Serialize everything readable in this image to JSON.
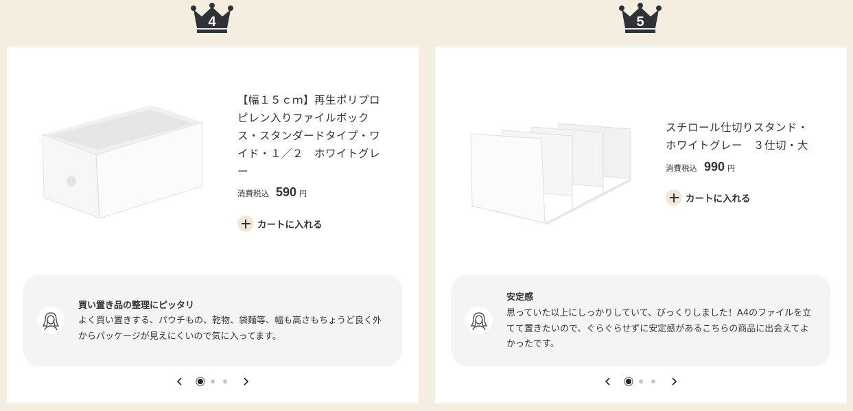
{
  "colors": {
    "background": "#f3eee0",
    "crown": "#2f3338",
    "card": "#ffffff",
    "review_bg": "#f4f4f3",
    "cart_circle": "#f0e9d6"
  },
  "products": [
    {
      "rank": "4",
      "title": "【幅１５ｃｍ】再生ポリプロピレン入りファイルボックス・スタンダードタイプ・ワイド・１／２　ホワイトグレー",
      "tax_label": "消費税込",
      "price": "590",
      "currency": "円",
      "cart_label": "カートに入れる",
      "image_icon": "file-box-image",
      "review": {
        "title": "買い置き品の整理にピッタリ",
        "body": "よく買い置きする、パウチもの、乾物、袋麺等、幅も高さもちょうど良く外からパッケージが見えにくいので気に入ってます。",
        "avatar_icon": "reviewer-avatar-icon"
      },
      "pager": {
        "total": 3,
        "active": 1
      }
    },
    {
      "rank": "5",
      "title": "スチロール仕切りスタンド・ホワイトグレー　３仕切・大",
      "tax_label": "消費税込",
      "price": "990",
      "currency": "円",
      "cart_label": "カートに入れる",
      "image_icon": "partition-stand-image",
      "review": {
        "title": "安定感",
        "body": "思っていた以上にしっかりしていて、びっくりしました！A4のファイルを立てて置きたいので、ぐらぐらせずに安定感があるこちらの商品に出会えてよかったです。",
        "avatar_icon": "reviewer-avatar-icon"
      },
      "pager": {
        "total": 3,
        "active": 1
      }
    }
  ]
}
